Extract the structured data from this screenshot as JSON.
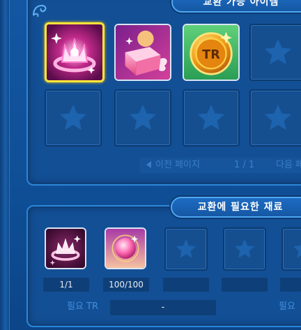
{
  "exchange_items": {
    "title": "교환 가능 아이템",
    "items": [
      {
        "icon": "flaming-crown-emblem-icon",
        "selected": true
      },
      {
        "icon": "winged-treasure-box-icon",
        "selected": false
      },
      {
        "icon": "tr-coin-icon",
        "selected": false,
        "coin_text": "TR"
      }
    ],
    "empty_slot_icon": "star-icon",
    "pager": {
      "prev_label": "이전 페이지",
      "page_text": "1 / 1",
      "next_label": "다음 페"
    }
  },
  "materials": {
    "title": "교환에 필요한 재료",
    "items": [
      {
        "icon": "crown-ring-material-icon",
        "qty": "1/1"
      },
      {
        "icon": "glowing-orb-material-icon",
        "qty": "100/100"
      }
    ],
    "required_tr_label": "필요 TR",
    "required_tr_value": "-",
    "required_tr_label_right": "필요"
  },
  "colors": {
    "selected_border": "#ffe53a",
    "panel_border": "#2c86d8",
    "label_blue": "#3f8fe0"
  }
}
